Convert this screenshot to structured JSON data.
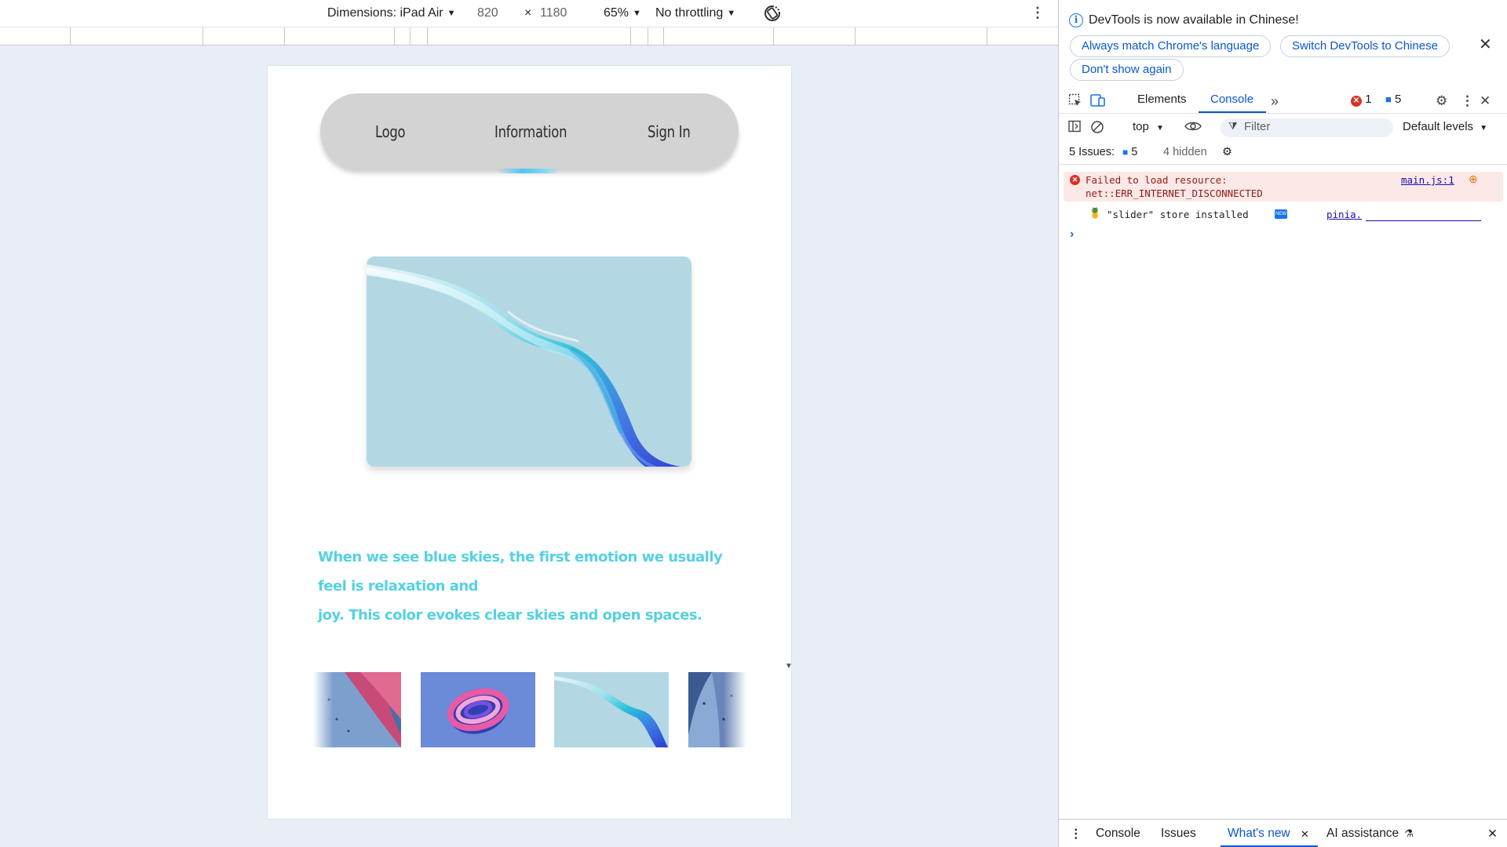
{
  "emulation": {
    "dimensions_label": "Dimensions: iPad Air",
    "width_value": "820",
    "times_symbol": "×",
    "height_value": "1180",
    "zoom": "65%",
    "throttling": "No throttling"
  },
  "site": {
    "nav": {
      "logo": "Logo",
      "information": "Information",
      "sign_in": "Sign In"
    },
    "caption_line1": "When we see blue skies, the first emotion we usually feel is relaxation and",
    "caption_line2": "joy. This color evokes clear skies and open spaces.",
    "accent_color": "#55d1e2"
  },
  "devtools": {
    "info_bar": {
      "message": "DevTools is now available in Chinese!",
      "btn_match": "Always match Chrome's language",
      "btn_switch": "Switch DevTools to Chinese",
      "btn_dont_show": "Don't show again"
    },
    "tabs": {
      "elements": "Elements",
      "console": "Console",
      "error_count": "1",
      "message_count": "5"
    },
    "filter": {
      "context": "top",
      "placeholder": "Filter",
      "levels": "Default levels"
    },
    "issues": {
      "label": "5 Issues:",
      "count": "5",
      "hidden": "4 hidden"
    },
    "console_rows": {
      "error_line1": "Failed to load resource:",
      "error_line2": "net::ERR_INTERNET_DISCONNECTED",
      "error_source": "main.js:1",
      "log_text": "\"slider\" store installed",
      "log_source": "pinia.",
      "prompt": "›"
    },
    "drawer": {
      "console": "Console",
      "issues": "Issues",
      "whats_new": "What's new",
      "ai_assistance": "AI assistance"
    }
  }
}
